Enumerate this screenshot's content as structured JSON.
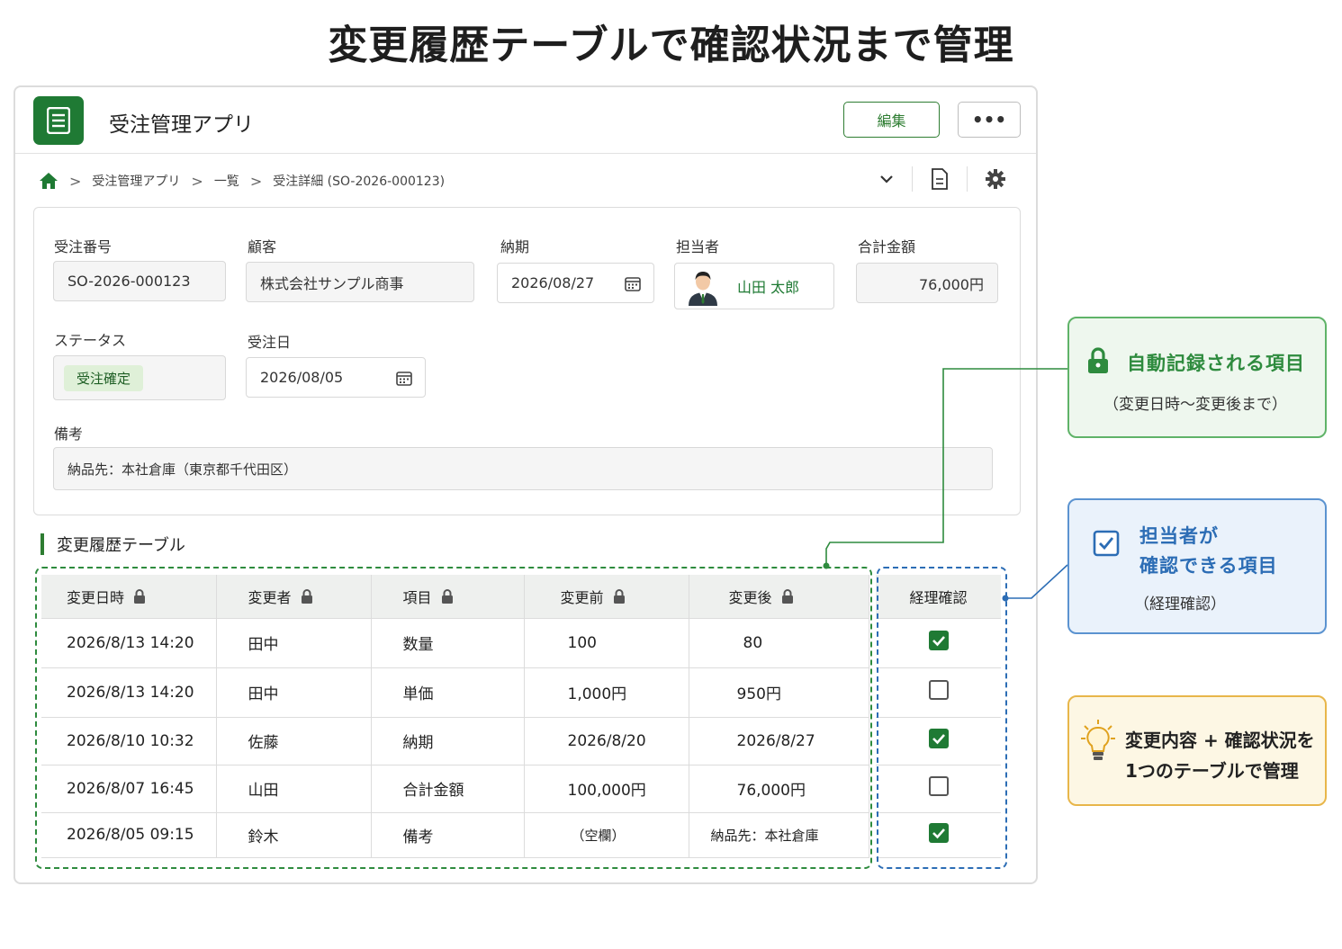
{
  "headline": "変更履歴テーブルで確認状況まで管理",
  "app": {
    "title": "受注管理アプリ",
    "edit_label": "編集",
    "more_label": "•••",
    "brand_color": "#1f7a34"
  },
  "breadcrumb": {
    "items": [
      "受注管理アプリ",
      "一覧",
      "受注詳細 (SO-2026-000123)"
    ]
  },
  "form": {
    "order_no": {
      "label": "受注番号",
      "value": "SO-2026-000123"
    },
    "customer": {
      "label": "顧客",
      "value": "株式会社サンプル商事"
    },
    "due_date": {
      "label": "納期",
      "value": "2026/08/27"
    },
    "assignee": {
      "label": "担当者",
      "value": "山田 太郎"
    },
    "total": {
      "label": "合計金額",
      "value": "76,000円"
    },
    "status": {
      "label": "ステータス",
      "value": "受注確定"
    },
    "order_date": {
      "label": "受注日",
      "value": "2026/08/05"
    },
    "notes": {
      "label": "備考",
      "value": "納品先：本社倉庫（東京都千代田区）"
    }
  },
  "history": {
    "title": "変更履歴テーブル",
    "columns": [
      "変更日時",
      "変更者",
      "項目",
      "変更前",
      "変更後",
      "経理確認"
    ],
    "rows": [
      {
        "datetime": "2026/8/13 14:20",
        "user": "田中",
        "item": "数量",
        "before": "100",
        "after": "80",
        "confirmed": true
      },
      {
        "datetime": "2026/8/13 14:20",
        "user": "田中",
        "item": "単価",
        "before": "1,000円",
        "after": "950円",
        "confirmed": false
      },
      {
        "datetime": "2026/8/10 10:32",
        "user": "佐藤",
        "item": "納期",
        "before": "2026/8/20",
        "after": "2026/8/27",
        "confirmed": true
      },
      {
        "datetime": "2026/8/07 16:45",
        "user": "山田",
        "item": "合計金額",
        "before": "100,000円",
        "after": "76,000円",
        "confirmed": false
      },
      {
        "datetime": "2026/8/05 09:15",
        "user": "鈴木",
        "item": "備考",
        "before": "（空欄）",
        "after": "納品先：本社倉庫",
        "confirmed": true
      }
    ]
  },
  "callouts": {
    "auto": {
      "title": "自動記録される項目",
      "sub": "（変更日時～変更後まで）",
      "color": "#2e8b3e"
    },
    "manual": {
      "title_line1": "担当者が",
      "title_line2": "確認できる項目",
      "sub": "（経理確認）",
      "color": "#2c6db5"
    },
    "tip": {
      "line1": "変更内容 + 確認状況を",
      "line2": "1つのテーブルで管理",
      "color": "#e8b64a"
    }
  }
}
